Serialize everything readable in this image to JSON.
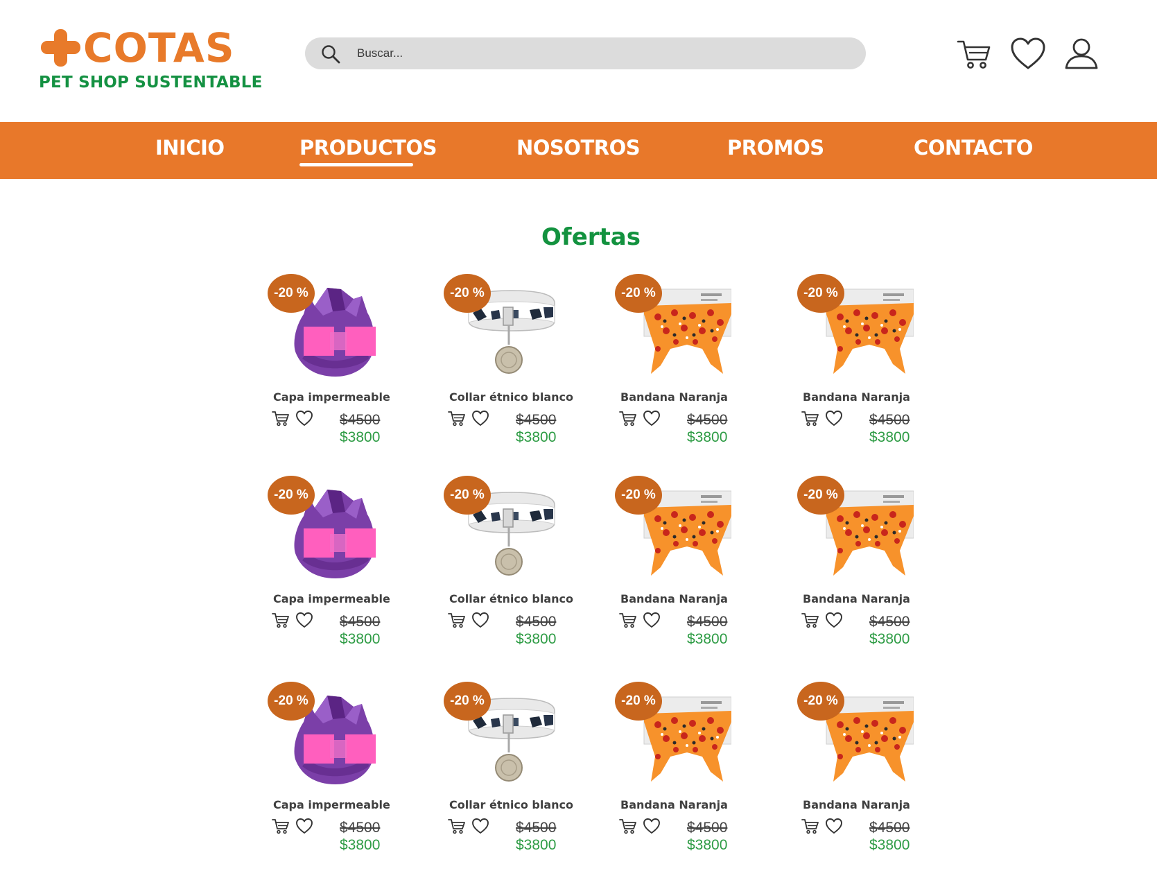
{
  "brand": {
    "name": "COTAS",
    "tagline": "PET SHOP SUSTENTABLE",
    "primary_color": "#E8782A",
    "secondary_color": "#149142"
  },
  "search": {
    "placeholder": "Buscar..."
  },
  "header_icons": [
    "cart-icon",
    "heart-icon",
    "user-icon"
  ],
  "nav": {
    "items": [
      "INICIO",
      "PRODUCTOS",
      "NOSOTROS",
      "PROMOS",
      "CONTACTO"
    ],
    "active": "PRODUCTOS"
  },
  "section": {
    "title": "Ofertas"
  },
  "products": [
    {
      "name": "Capa impermeable",
      "badge": "-20 %",
      "old_price": "$4500",
      "price": "$3800",
      "image": "purple-raincoat"
    },
    {
      "name": "Collar étnico blanco",
      "badge": "-20 %",
      "old_price": "$4500",
      "price": "$3800",
      "image": "ethnic-collar"
    },
    {
      "name": "Bandana Naranja",
      "badge": "-20 %",
      "old_price": "$4500",
      "price": "$3800",
      "image": "orange-bandana"
    },
    {
      "name": "Bandana Naranja",
      "badge": "-20 %",
      "old_price": "$4500",
      "price": "$3800",
      "image": "orange-bandana"
    },
    {
      "name": "Capa impermeable",
      "badge": "-20 %",
      "old_price": "$4500",
      "price": "$3800",
      "image": "purple-raincoat"
    },
    {
      "name": "Collar étnico blanco",
      "badge": "-20 %",
      "old_price": "$4500",
      "price": "$3800",
      "image": "ethnic-collar"
    },
    {
      "name": "Bandana Naranja",
      "badge": "-20 %",
      "old_price": "$4500",
      "price": "$3800",
      "image": "orange-bandana"
    },
    {
      "name": "Bandana Naranja",
      "badge": "-20 %",
      "old_price": "$4500",
      "price": "$3800",
      "image": "orange-bandana"
    },
    {
      "name": "Capa impermeable",
      "badge": "-20 %",
      "old_price": "$4500",
      "price": "$3800",
      "image": "purple-raincoat"
    },
    {
      "name": "Collar étnico blanco",
      "badge": "-20 %",
      "old_price": "$4500",
      "price": "$3800",
      "image": "ethnic-collar"
    },
    {
      "name": "Bandana Naranja",
      "badge": "-20 %",
      "old_price": "$4500",
      "price": "$3800",
      "image": "orange-bandana"
    },
    {
      "name": "Bandana Naranja",
      "badge": "-20 %",
      "old_price": "$4500",
      "price": "$3800",
      "image": "orange-bandana"
    }
  ],
  "colors": {
    "badge": "#C8661E",
    "new_price": "#2E9C45",
    "title": "#13923F",
    "search_bg": "#dcdcdc"
  }
}
